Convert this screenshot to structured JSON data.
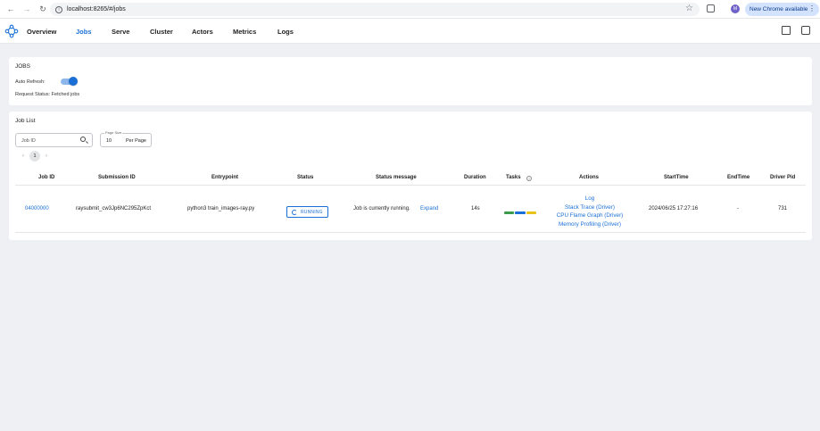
{
  "browser": {
    "url": "localhost:8265/#/jobs",
    "profile_initial": "M",
    "new_chrome_label": "New Chrome available",
    "menu_glyph": "⋮"
  },
  "nav": {
    "items": [
      {
        "label": "Overview",
        "active": false
      },
      {
        "label": "Jobs",
        "active": true
      },
      {
        "label": "Serve",
        "active": false
      },
      {
        "label": "Cluster",
        "active": false
      },
      {
        "label": "Actors",
        "active": false
      },
      {
        "label": "Metrics",
        "active": false
      },
      {
        "label": "Logs",
        "active": false
      }
    ],
    "icons": [
      "docs-icon",
      "feedback-icon"
    ]
  },
  "jobs_panel": {
    "title": "JOBS",
    "auto_refresh_label": "Auto Refresh:",
    "auto_refresh_on": true,
    "request_status": "Request Status: Fetched jobs"
  },
  "job_list": {
    "title": "Job List",
    "search_placeholder": "Job ID",
    "page_size_label": "Page Size",
    "page_size_value": "10",
    "page_size_suffix": "Per Page",
    "pagination": {
      "prev": "‹",
      "current": "1",
      "next": "›"
    },
    "columns": [
      "Job ID",
      "Submission ID",
      "Entrypoint",
      "Status",
      "Status message",
      "Duration",
      "Tasks",
      "Actions",
      "StartTime",
      "EndTime",
      "Driver Pid"
    ],
    "rows": [
      {
        "job_id": "04000000",
        "submission_id": "raysubmit_cw3Jp6NC295ZpKct",
        "entrypoint": "python3 train_images-ray.py",
        "status": "RUNNING",
        "status_message": "Job is currently running.",
        "expand_label": "Expand",
        "duration": "14s",
        "actions": [
          "Log",
          "Stack Trace (Driver)",
          "CPU Flame Graph (Driver)",
          "Memory Profiling (Driver)"
        ],
        "start_time": "2024/06/25 17:27:16",
        "end_time": "-",
        "driver_pid": "731"
      }
    ]
  },
  "colors": {
    "accent": "#1a6fd6",
    "task_green": "#3a9c4a",
    "task_blue": "#1a6fd6",
    "task_yellow": "#e8c31c"
  }
}
